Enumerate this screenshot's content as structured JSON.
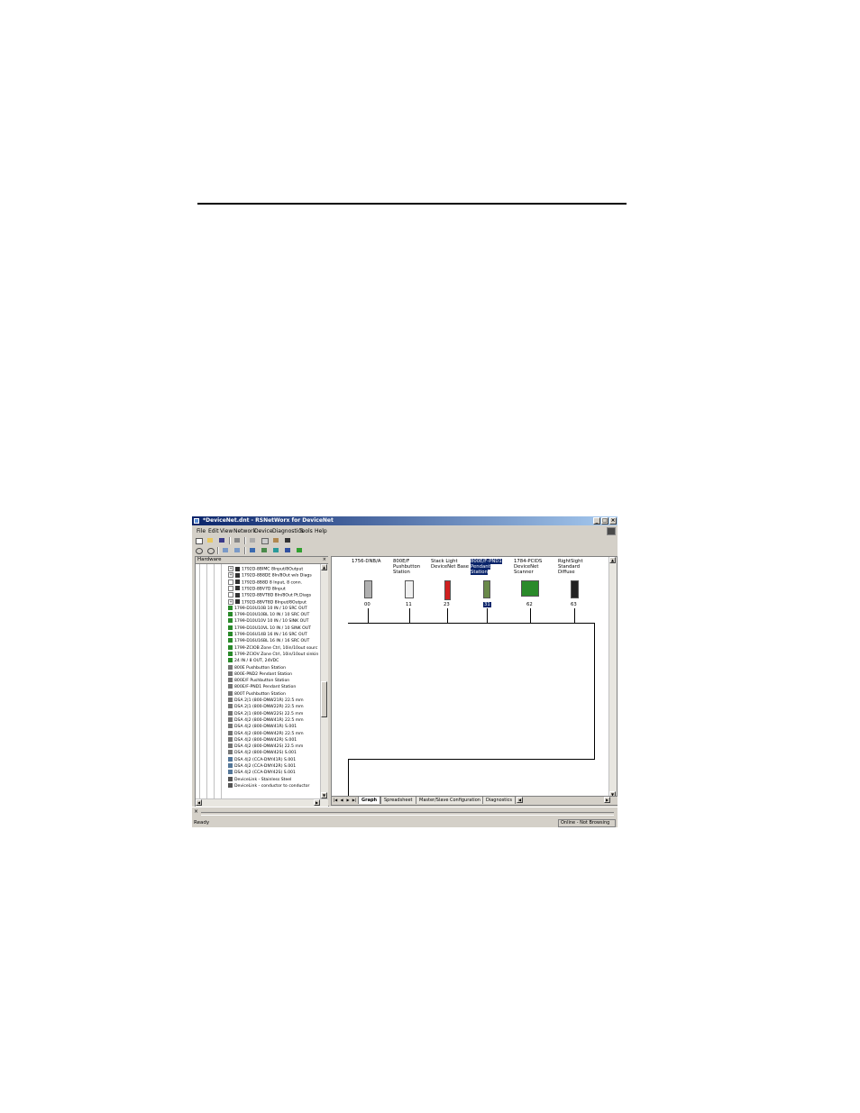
{
  "window": {
    "title": "*DeviceNet.dnt - RSNetWorx for DeviceNet"
  },
  "menu": [
    "File",
    "Edit",
    "View",
    "Network",
    "Device",
    "Diagnostics",
    "Tools",
    "Help"
  ],
  "toolbar1": [
    "new-icon",
    "open-icon",
    "save-icon",
    "print-icon",
    "cut-icon",
    "copy-icon",
    "paste-icon",
    "whats-this-icon"
  ],
  "toolbar2": [
    "zoom-in-icon",
    "zoom-out-icon",
    "single-pass-browse-icon",
    "continuous-browse-icon",
    "upload-download-icon",
    "network-icon",
    "diagnostics-icon",
    "properties-icon",
    "edc-icon"
  ],
  "hardware_panel": {
    "title": "Hardware",
    "items": [
      "1792D-8BIMC 8Input/8Output",
      "1792D-8B8DE 8In/8Out w/o Diags",
      "1792D-8B8D 8 Input, 8 conn.",
      "1792D-8BV7D 8Input",
      "1792D-8BVT8D 8In/8Out Pt.Diags",
      "1792D-8BVT8D 8Input/8Output",
      "1799-D10U10B 10 IN / 10 SRC OUT",
      "1799-D10U10BL 10 IN / 10 SRC OUT",
      "1799-D10U10V 10 IN / 10 SINK OUT",
      "1799-D10U10VL 10 IN / 10 SINK OUT",
      "1799-D16U14B 16 IN / 16 SRC OUT",
      "1799-D16U16BL 16 IN / 16 SRC OUT",
      "1799-ZCIOB Zone Ctrl, 10in/10out sourc",
      "1799-ZCIOV Zone Ctrl, 10in/10out sinkin",
      "24 IN / 8 OUT, 24VDC",
      "800E Pushbutton Station",
      "800E-PND2 Pendant Station",
      "800E/F Pushbutton Station",
      "800E/F-PND1 Pendant Station",
      "800T Pushbutton Station",
      "DSA 2|1 (800-DNW21R) 22.5 mm",
      "DSA 2|1 (800-DNW22R) 22.5 mm",
      "DSA 2|1 (800-DNW22S) 22.5 mm",
      "DSA 4|2 (800-DNW41R) 22.5 mm",
      "DSA 4|2 (800-DNW41R) S.001",
      "DSA 4|2 (800-DNW42R) 22.5 mm",
      "DSA 4|2 (800-DNW42R) S.001",
      "DSA 4|2 (800-DNW42S) 22.5 mm",
      "DSA 4|2 (800-DNW42S) S.001",
      "DSA 4|2 (CCA-DNY41R) S.001",
      "DSA 4|2 (CCA-DNY42R) S.001",
      "DSA 4|2 (CCA-DNY42S) S.001",
      "DeviceLink - Stainless Steel",
      "DeviceLink - conductor to conductor"
    ]
  },
  "devices": [
    {
      "name": "1756-DNB/A",
      "address": "00",
      "selected": false
    },
    {
      "name": "800E/F\nPushbutton\nStation",
      "address": "11",
      "selected": false
    },
    {
      "name": "Stack Light\nDeviceNet Base",
      "address": "23",
      "selected": false
    },
    {
      "name": "800E/F-PND1\nPendant\nStation",
      "address": "31",
      "selected": true
    },
    {
      "name": "1784-PCIDS\nDeviceNet\nScanner",
      "address": "62",
      "selected": false
    },
    {
      "name": "RightSight\nStandard\nDiffuse",
      "address": "63",
      "selected": false
    }
  ],
  "tabs": [
    {
      "label": "Graph",
      "active": true
    },
    {
      "label": "Spreadsheet",
      "active": false
    },
    {
      "label": "Master/Slave Configuration",
      "active": false
    },
    {
      "label": "Diagnostics",
      "active": false
    }
  ],
  "status": {
    "left": "Ready",
    "right": "Online - Not Browsing"
  }
}
